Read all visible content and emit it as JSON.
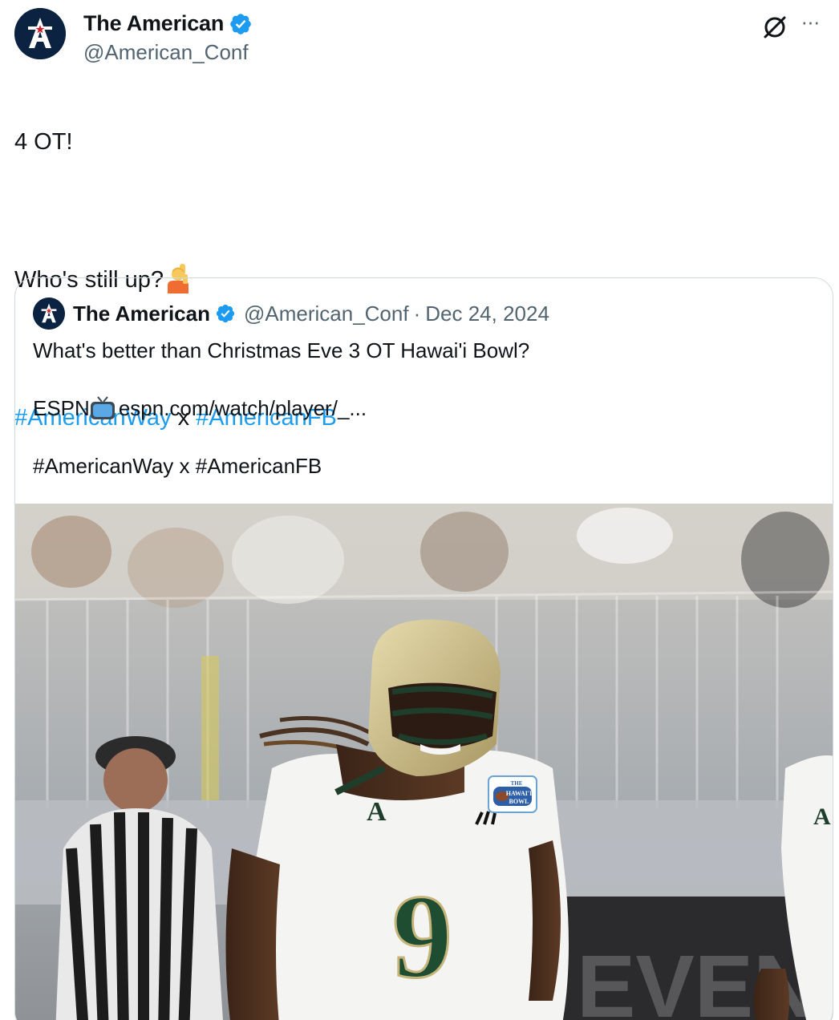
{
  "author": {
    "name": "The American",
    "handle": "@American_Conf"
  },
  "tweet": {
    "line1": "4 OT!",
    "line2": "Who's still up?",
    "emoji": "person-raising-hand",
    "hashtag1": "#AmericanWay",
    "separator": " x ",
    "hashtag2": "#AmericanFB"
  },
  "quoted": {
    "name": "The American",
    "handle": "@American_Conf",
    "dot": "·",
    "date": "Dec 24, 2024",
    "line1": "What's better than Christmas Eve 3 OT Hawai'i Bowl?",
    "espn_prefix": "ESPN",
    "emoji": "television",
    "link": "espn.com/watch/player/_...",
    "hashtags": "#AmericanWay x #AmericanFB",
    "media": {
      "jersey_number": "9",
      "patch_text_top": "THE",
      "patch_text_mid": "HAWAI'I",
      "patch_text_bottom": "BOWL",
      "banner_text": "EVENT"
    }
  },
  "icons": {
    "verified": "verified-badge-icon",
    "grok": "grok-icon",
    "more": "more-icon"
  },
  "colors": {
    "accent": "#1d9bf0",
    "text": "#0f1419",
    "secondary": "#536471",
    "border": "#cfd9de"
  }
}
